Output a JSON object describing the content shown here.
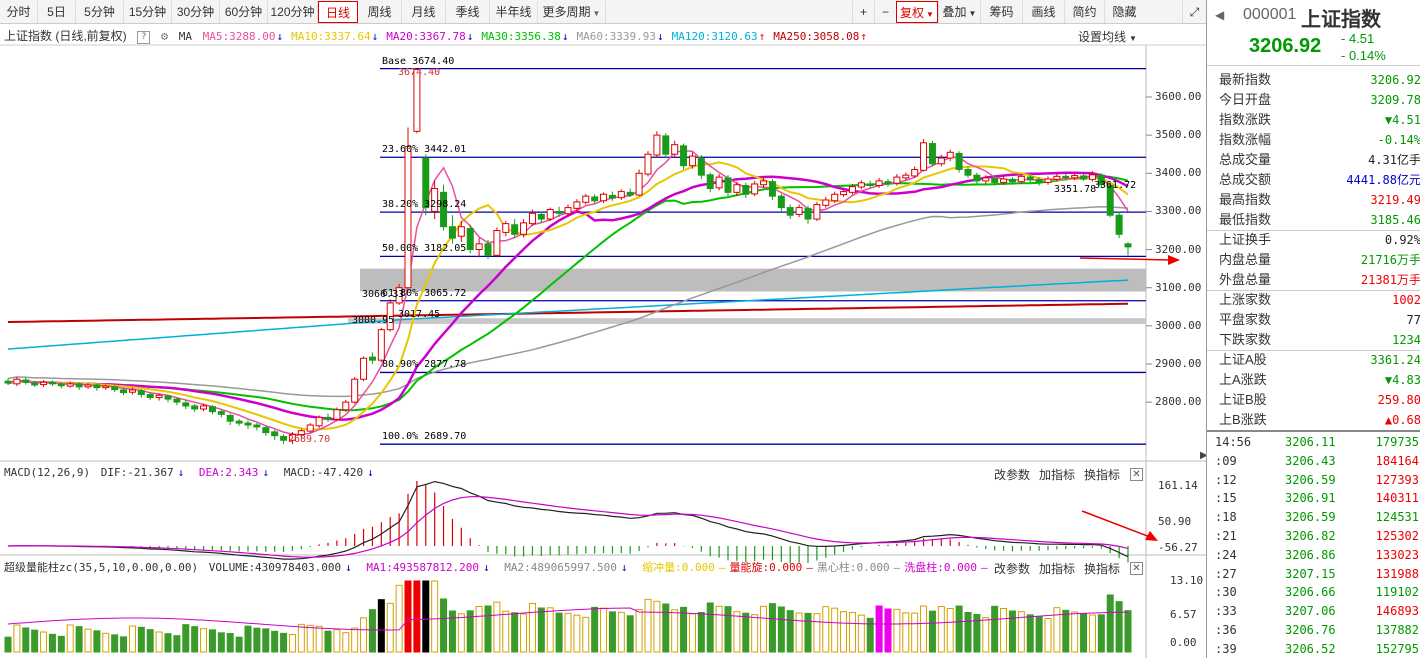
{
  "toolbar": {
    "periods": [
      "分时",
      "5日",
      "5分钟",
      "15分钟",
      "30分钟",
      "60分钟",
      "120分钟",
      "日线",
      "周线",
      "月线",
      "季线",
      "半年线",
      "更多周期"
    ],
    "active_period": "日线",
    "more_periods": "更多周期",
    "tools": [
      "+",
      "−",
      "复权",
      "叠加",
      "筹码",
      "画线",
      "简约",
      "隐藏"
    ],
    "active_tool": "复权",
    "expand_icon": "expand-icon"
  },
  "main_pane": {
    "title": "上证指数 (日线,前复权)",
    "help": "?",
    "ma_label": "MA",
    "ma_items": [
      {
        "text": "MA5:3288.00",
        "dir": "↓",
        "color": "#e94ea0"
      },
      {
        "text": "MA10:3337.64",
        "dir": "↓",
        "color": "#e6c800"
      },
      {
        "text": "MA20:3367.78",
        "dir": "↓",
        "color": "#cc00cc"
      },
      {
        "text": "MA30:3356.38",
        "dir": "↓",
        "color": "#00c000"
      },
      {
        "text": "MA60:3339.93",
        "dir": "↓",
        "color": "#999999"
      },
      {
        "text": "MA120:3120.63",
        "dir": "↑",
        "color": "#00b0d8"
      },
      {
        "text": "MA250:3058.08",
        "dir": "↑",
        "color": "#c00000"
      }
    ],
    "settings": "设置均线",
    "y_ticks": [
      "3600.00",
      "3500.00",
      "3400.00",
      "3300.00",
      "3200.00",
      "3100.00",
      "3000.00",
      "2900.00",
      "2800.00"
    ],
    "fib_levels": [
      {
        "label": "Base  3674.40",
        "value": 3674.4
      },
      {
        "label": "23.60% 3442.01",
        "value": 3442.01
      },
      {
        "label": "38.20% 3298.24",
        "value": 3298.24
      },
      {
        "label": "50.00% 3182.05",
        "value": 3182.05
      },
      {
        "label": "61.80% 3065.72",
        "value": 3065.72
      },
      {
        "label": "80.90% 2877.78",
        "value": 2877.78
      },
      {
        "label": "100.0% 2689.70",
        "value": 2689.7
      }
    ],
    "annotations": [
      {
        "text": "3674.40",
        "value": 3674.4
      },
      {
        "text": "2689.70",
        "value": 2689.7
      },
      {
        "text": "3066.33",
        "value": 3066.33
      },
      {
        "text": "3000.95",
        "value": 3000.95
      },
      {
        "text": "3017.45",
        "value": 3017.45
      },
      {
        "text": "3351.78",
        "value": 3351.78
      },
      {
        "text": "3361.72",
        "value": 3361.72
      }
    ]
  },
  "macd_pane": {
    "title": "MACD(12,26,9)",
    "dif": "DIF:-21.367",
    "dif_dir": "↓",
    "dea": "DEA:2.343",
    "dea_dir": "↓",
    "macd": "MACD:-47.420",
    "macd_dir": "↓",
    "buttons": [
      "改参数",
      "加指标",
      "换指标"
    ],
    "y_ticks": [
      "161.14",
      "50.90",
      "-56.27"
    ]
  },
  "vol_pane": {
    "title": "超级量能柱zc(35,5,10,0.00,0.00)",
    "volume": "VOLUME:430978403.000",
    "volume_dir": "↓",
    "ma1": "MA1:493587812.200",
    "ma1_dir": "↓",
    "ma2": "MA2:489065997.500",
    "ma2_dir": "↓",
    "extra": [
      {
        "text": "缩冲量:0.000",
        "color": "#e6c800"
      },
      {
        "text": "量能旋:0.000",
        "color": "#e00000"
      },
      {
        "text": "黑心柱:0.000",
        "color": "#888888"
      },
      {
        "text": "洗盘柱:0.000",
        "color": "#cc00cc"
      }
    ],
    "buttons": [
      "改参数",
      "加指标",
      "换指标"
    ],
    "y_ticks": [
      "13.10",
      "6.57",
      "0.00"
    ]
  },
  "side": {
    "code": "000001",
    "name": "上证指数",
    "price": "3206.92",
    "change": "- 4.51",
    "change_pct": "- 0.14%",
    "rows": [
      {
        "label": "最新指数",
        "value": "3206.92",
        "color": "green"
      },
      {
        "label": "今日开盘",
        "value": "3209.78",
        "color": "green"
      },
      {
        "label": "指数涨跌",
        "value": "▼4.51",
        "color": "green"
      },
      {
        "label": "指数涨幅",
        "value": "-0.14%",
        "color": "green"
      },
      {
        "label": "总成交量",
        "value": "4.31亿手",
        "color": "black"
      },
      {
        "label": "总成交额",
        "value": "4441.88亿元",
        "color": "blue"
      },
      {
        "label": "最高指数",
        "value": "3219.49",
        "color": "red"
      },
      {
        "label": "最低指数",
        "value": "3185.46",
        "color": "green"
      },
      {
        "label": "上证换手",
        "value": "0.92%",
        "color": "black"
      },
      {
        "label": "内盘总量",
        "value": "21716万手",
        "color": "green"
      },
      {
        "label": "外盘总量",
        "value": "21381万手",
        "color": "red"
      },
      {
        "label": "上涨家数",
        "value": "1002",
        "color": "red"
      },
      {
        "label": "平盘家数",
        "value": "77",
        "color": "black"
      },
      {
        "label": "下跌家数",
        "value": "1234",
        "color": "green"
      },
      {
        "label": "上证A股",
        "value": "3361.24",
        "color": "green"
      },
      {
        "label": "上A涨跌",
        "value": "▼4.83",
        "color": "green"
      },
      {
        "label": "上证B股",
        "value": "259.80",
        "color": "red"
      },
      {
        "label": "上B涨跌",
        "value": "▲0.68",
        "color": "red"
      }
    ],
    "ticks": [
      {
        "time": "14:56",
        "price": "3206.11",
        "vol": "179735",
        "vcolor": "green"
      },
      {
        "time": ":09",
        "price": "3206.43",
        "vol": "184164",
        "vcolor": "red"
      },
      {
        "time": ":12",
        "price": "3206.59",
        "vol": "127393",
        "vcolor": "red"
      },
      {
        "time": ":15",
        "price": "3206.91",
        "vol": "140311",
        "vcolor": "red"
      },
      {
        "time": ":18",
        "price": "3206.59",
        "vol": "124531",
        "vcolor": "green"
      },
      {
        "time": ":21",
        "price": "3206.82",
        "vol": "125302",
        "vcolor": "red"
      },
      {
        "time": ":24",
        "price": "3206.86",
        "vol": "133023",
        "vcolor": "red"
      },
      {
        "time": ":27",
        "price": "3207.15",
        "vol": "131988",
        "vcolor": "red"
      },
      {
        "time": ":30",
        "price": "3206.66",
        "vol": "119102",
        "vcolor": "green"
      },
      {
        "time": ":33",
        "price": "3207.06",
        "vol": "146893",
        "vcolor": "red"
      },
      {
        "time": ":36",
        "price": "3206.76",
        "vol": "137882",
        "vcolor": "green"
      },
      {
        "time": ":39",
        "price": "3206.52",
        "vol": "152795",
        "vcolor": "green"
      }
    ]
  },
  "colors": {
    "up": "#e00000",
    "down": "#1a9a1a",
    "fib_line": "#0000aa",
    "ma5": "#e94ea0",
    "ma10": "#e6c800",
    "ma20": "#cc00cc",
    "ma30": "#00c000",
    "ma60": "#999999",
    "ma120": "#00b0d8",
    "ma250": "#c00000"
  }
}
